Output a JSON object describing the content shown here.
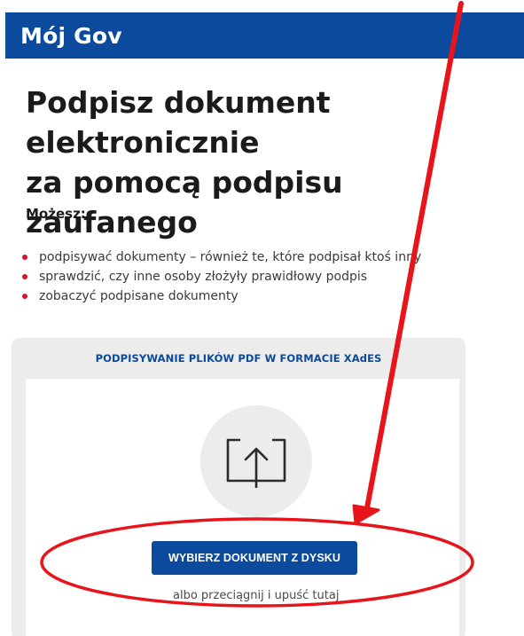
{
  "header": {
    "app_title": "Mój Gov"
  },
  "main": {
    "title_line1": "Podpisz dokument elektronicznie",
    "title_line2": "za pomocą podpisu zaufanego",
    "can_label": "Możesz:",
    "bullets": [
      "podpisywać dokumenty – również te, które podpisał ktoś inny",
      "sprawdzić, czy inne osoby złożyły prawidłowy podpis",
      "zobaczyć podpisane dokumenty"
    ]
  },
  "upload_card": {
    "header": "PODPISYWANIE PLIKÓW PDF W FORMACIE XAdES",
    "upload_icon": "upload-arrow-icon",
    "choose_button_label": "WYBIERZ DOKUMENT Z DYSKU",
    "drop_hint": "albo przeciągnij i upuść tutaj"
  },
  "colors": {
    "brand_blue": "#0b4a9c",
    "bullet_red": "#d6132a",
    "annotation_red": "#e8141c",
    "card_gray": "#ececec"
  }
}
